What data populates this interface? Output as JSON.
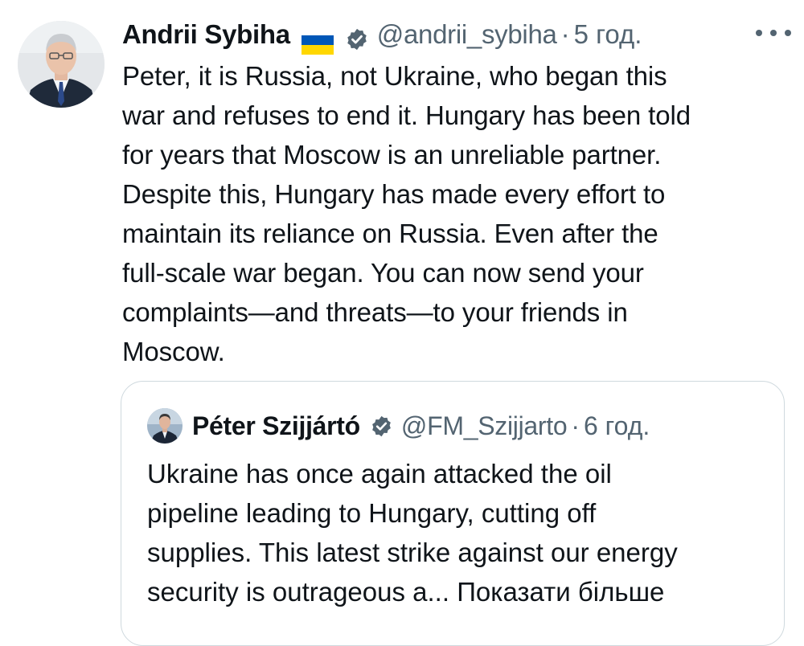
{
  "tweet": {
    "author_name": "Andrii Sybiha",
    "flag_icon": "ukraine-flag-icon",
    "verified_icon": "verified-badge-icon",
    "verified_color": "#536471",
    "handle": "@andrii_sybiha",
    "separator": "·",
    "time": "5 год.",
    "more_icon": "more-options-icon",
    "text_lines": [
      "Peter, it is Russia, not Ukraine, who began this",
      "war and refuses to end it. Hungary has been told",
      "for years that Moscow is an unreliable partner.",
      "Despite this, Hungary has made every effort to",
      "maintain its reliance on Russia. Even after the",
      "full-scale war began. You can now send your",
      "complaints—and threats—to your friends in",
      "Moscow."
    ]
  },
  "quote": {
    "author_name": "Péter Szijjártó",
    "verified_icon": "verified-badge-icon",
    "handle": "@FM_Szijjarto",
    "separator": "·",
    "time": "6 год.",
    "text_lines": [
      "Ukraine has once again attacked the oil",
      "pipeline leading to Hungary, cutting off",
      "supplies. This latest strike against our energy",
      "security is outrageous a..."
    ],
    "show_more": "Показати більше"
  },
  "colors": {
    "text": "#0f1419",
    "secondary": "#536471",
    "border": "#cfd9de",
    "flag_blue": "#0057b7",
    "flag_yellow": "#ffd700"
  }
}
